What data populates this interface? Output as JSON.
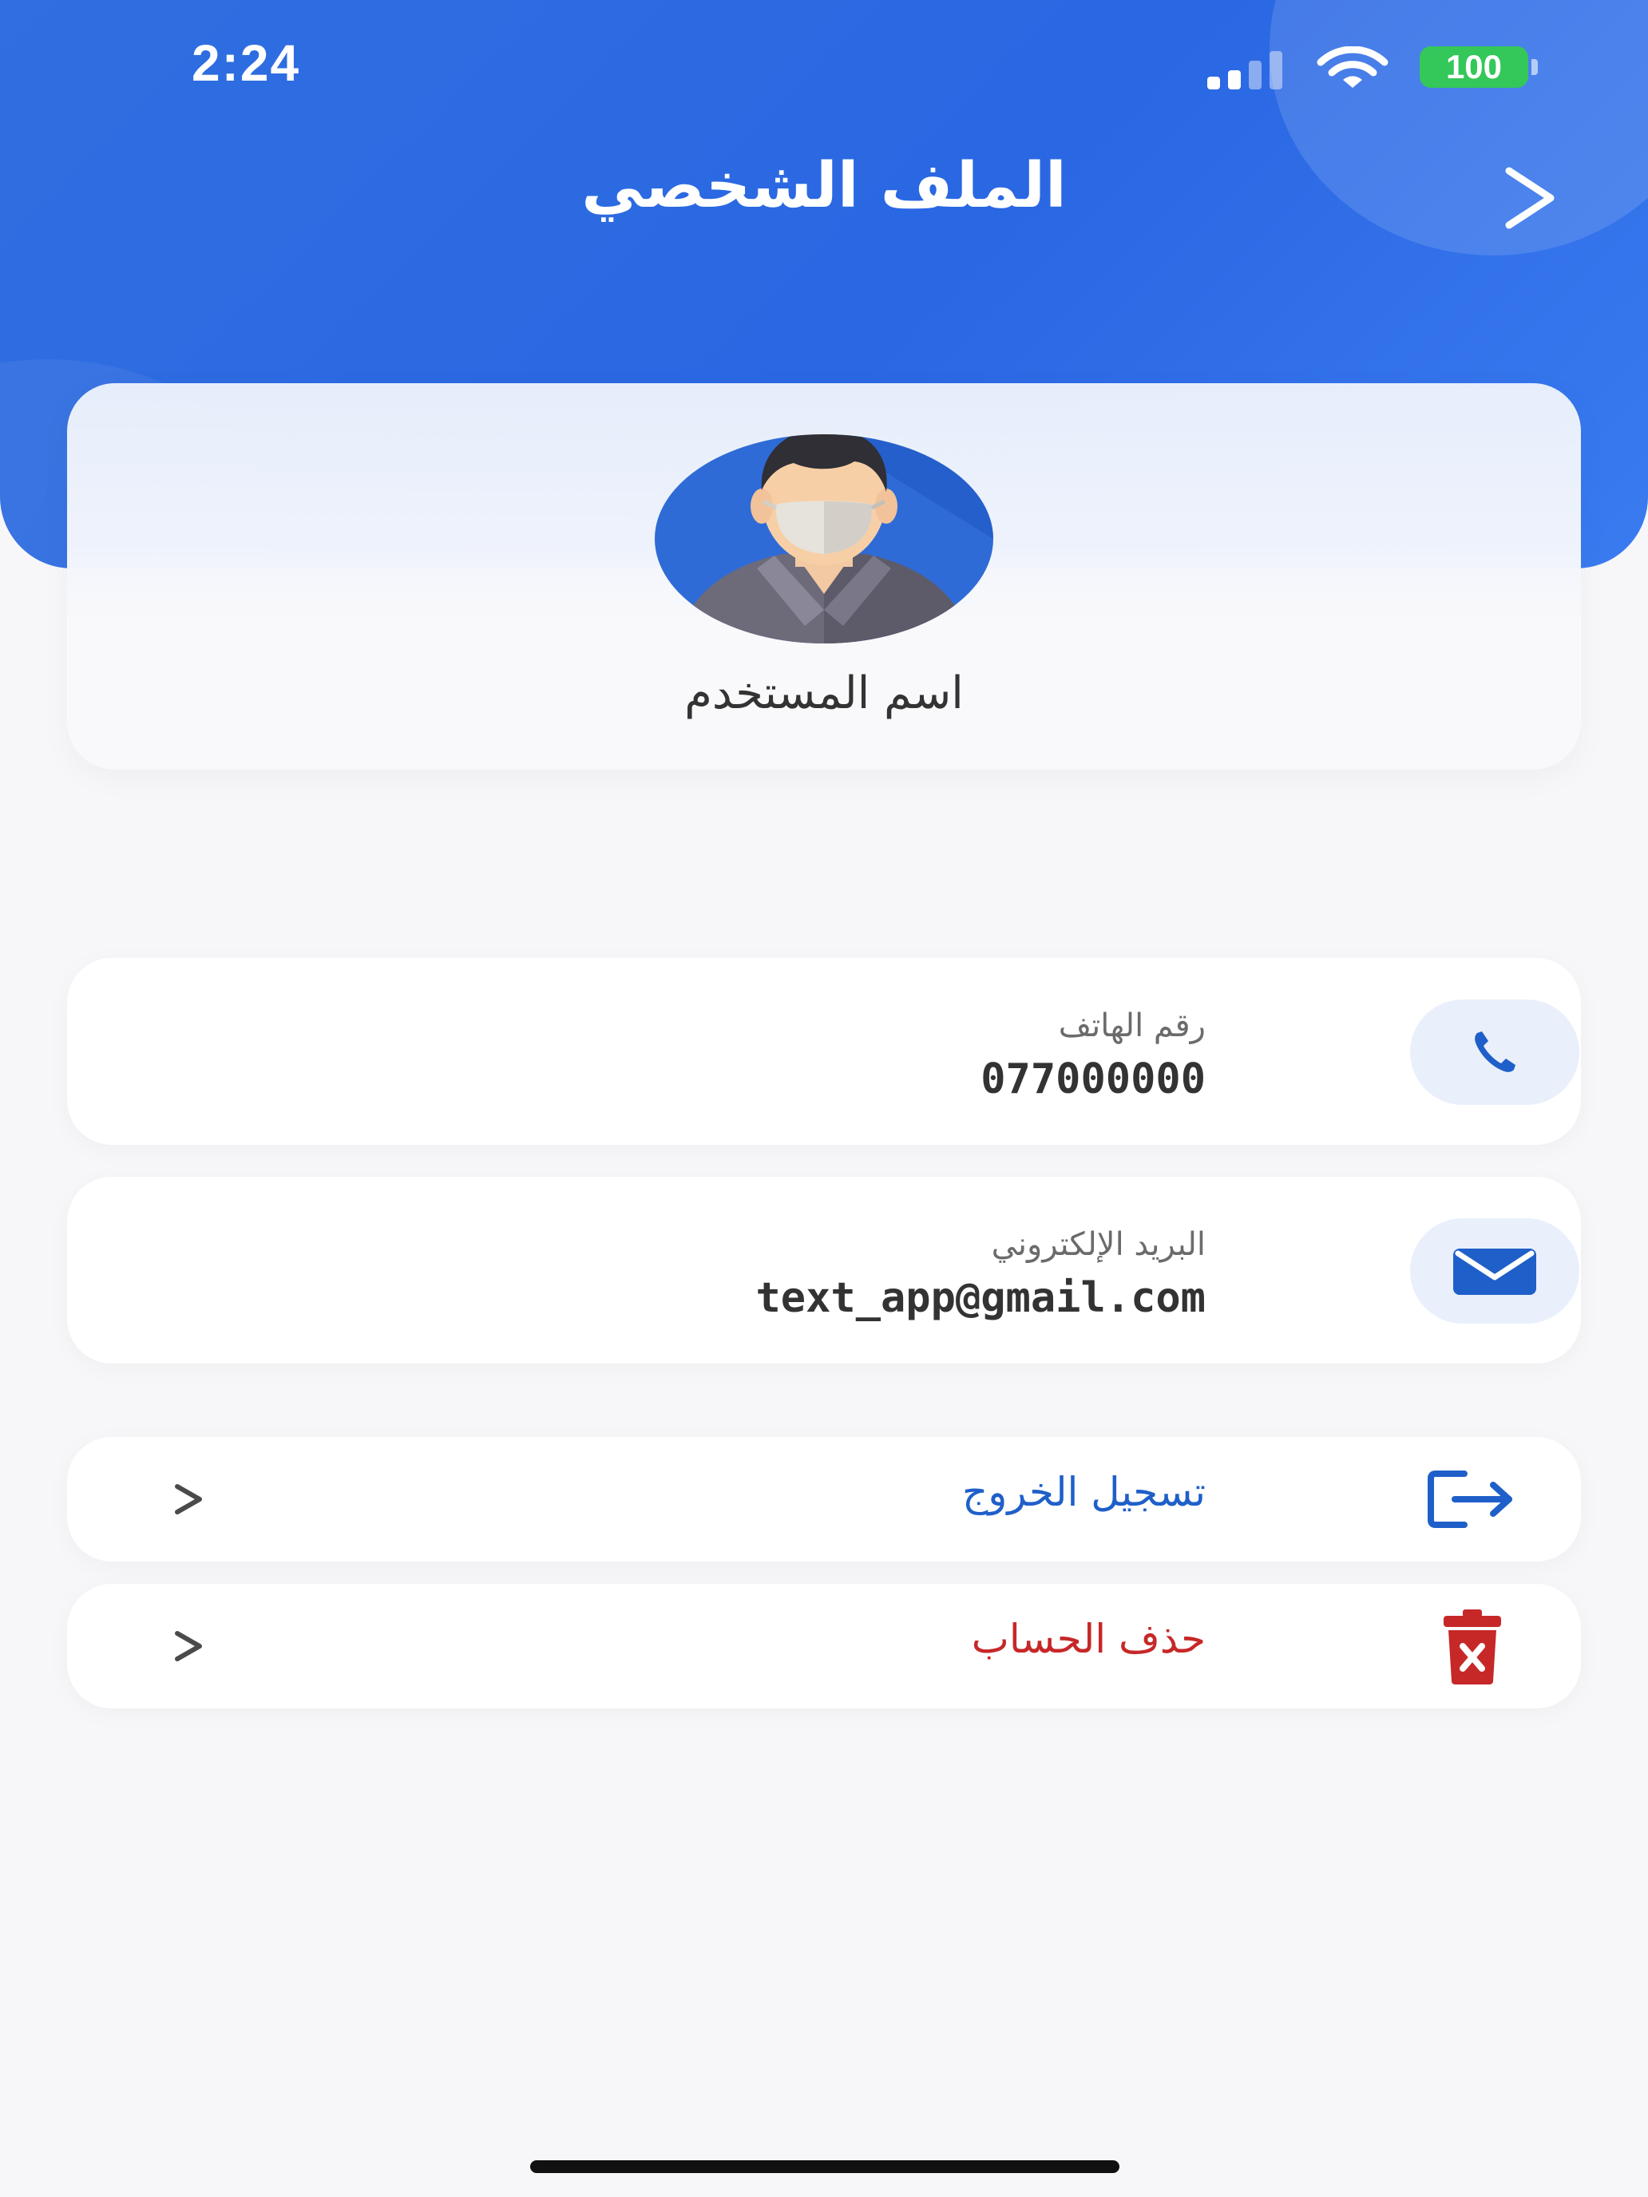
{
  "status_bar": {
    "time": "2:24",
    "battery": "100",
    "icons": [
      "signal-icon",
      "wifi-icon",
      "battery-icon"
    ]
  },
  "header": {
    "title": "الملف الشخصي",
    "back_icon": "chevron-right-icon"
  },
  "profile": {
    "avatar_icon": "masked-user-avatar",
    "username": "اسم المستخدم"
  },
  "contact": {
    "phone": {
      "label": "رقم الهاتف",
      "value": "077000000",
      "icon": "phone-icon"
    },
    "email": {
      "label": "البريد الإلكتروني",
      "value": "text_app@gmail.com",
      "icon": "mail-icon"
    }
  },
  "actions": {
    "logout": {
      "label": "تسجيل الخروج",
      "icon": "logout-icon"
    },
    "delete_account": {
      "label": "حذف الحساب",
      "icon": "trash-icon"
    }
  },
  "colors": {
    "primary": "#2f6fe0",
    "logout": "#1f5fc9",
    "delete": "#c62828",
    "battery": "#34c759",
    "background": "#f7f7f9"
  }
}
